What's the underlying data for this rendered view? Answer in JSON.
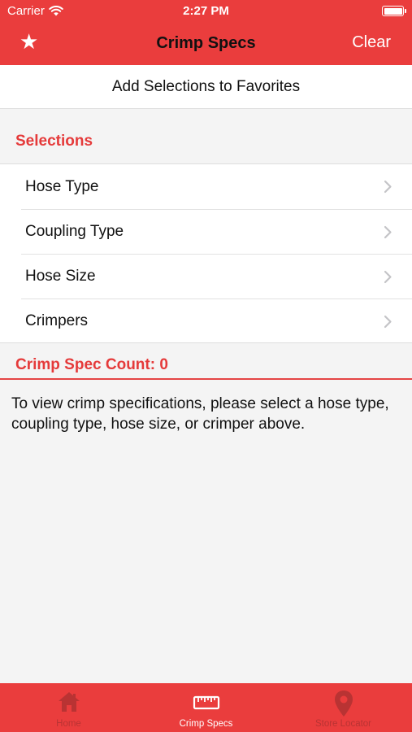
{
  "status_bar": {
    "carrier": "Carrier",
    "time": "2:27 PM"
  },
  "nav": {
    "title": "Crimp Specs",
    "clear_label": "Clear",
    "star_icon": "star-icon"
  },
  "favorites_label": "Add Selections to Favorites",
  "section_title": "Selections",
  "selections": [
    {
      "label": "Hose Type"
    },
    {
      "label": "Coupling Type"
    },
    {
      "label": "Hose Size"
    },
    {
      "label": "Crimpers"
    }
  ],
  "count_label": "Crimp Spec Count: 0",
  "info_text": "To view crimp specifications, please select a hose type, coupling type, hose size, or crimper above.",
  "tabs": [
    {
      "label": "Home",
      "icon": "home-icon",
      "active": false
    },
    {
      "label": "Crimp Specs",
      "icon": "ruler-icon",
      "active": true
    },
    {
      "label": "Store Locator",
      "icon": "location-pin-icon",
      "active": false
    }
  ],
  "colors": {
    "brand_red": "#ea3d3d",
    "accent_red": "#e53a3a",
    "inactive_tab": "#b93333"
  }
}
